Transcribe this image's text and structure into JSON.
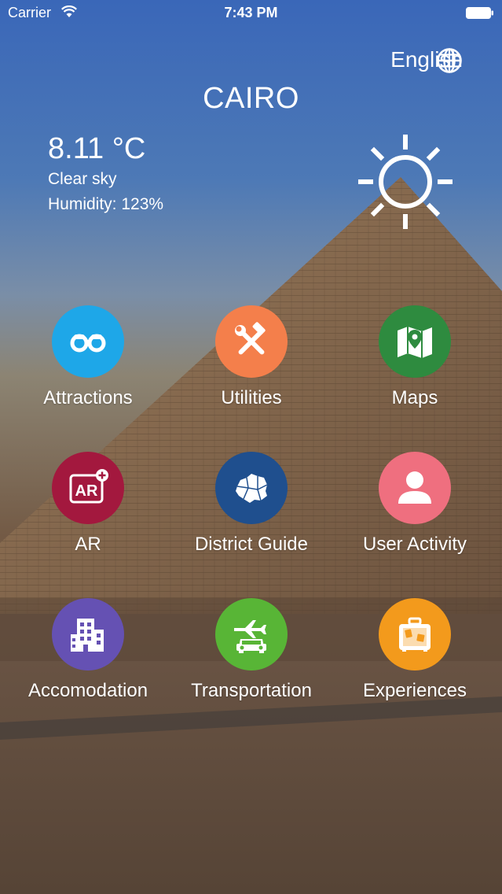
{
  "status_bar": {
    "carrier": "Carrier",
    "time": "7:43 PM"
  },
  "header": {
    "language": "English",
    "city": "CAIRO"
  },
  "weather": {
    "temperature": "8.11 °C",
    "description": "Clear sky",
    "humidity": "Humidity: 123%",
    "icon": "sun-icon"
  },
  "menu": [
    {
      "label": "Attractions",
      "color": "#1ea7e8",
      "icon": "binoculars-icon"
    },
    {
      "label": "Utilities",
      "color": "#f47f4b",
      "icon": "tools-icon"
    },
    {
      "label": "Maps",
      "color": "#2e8b3f",
      "icon": "map-pin-icon"
    },
    {
      "label": "AR",
      "color": "#a3183e",
      "icon": "ar-plus-icon"
    },
    {
      "label": "District Guide",
      "color": "#1f4f8e",
      "icon": "district-map-icon"
    },
    {
      "label": "User Activity",
      "color": "#ef6f7f",
      "icon": "user-icon"
    },
    {
      "label": "Accomodation",
      "color": "#6551b3",
      "icon": "building-icon"
    },
    {
      "label": "Transportation",
      "color": "#58b536",
      "icon": "plane-car-icon"
    },
    {
      "label": "Experiences",
      "color": "#f39a1c",
      "icon": "suitcase-icon"
    }
  ]
}
